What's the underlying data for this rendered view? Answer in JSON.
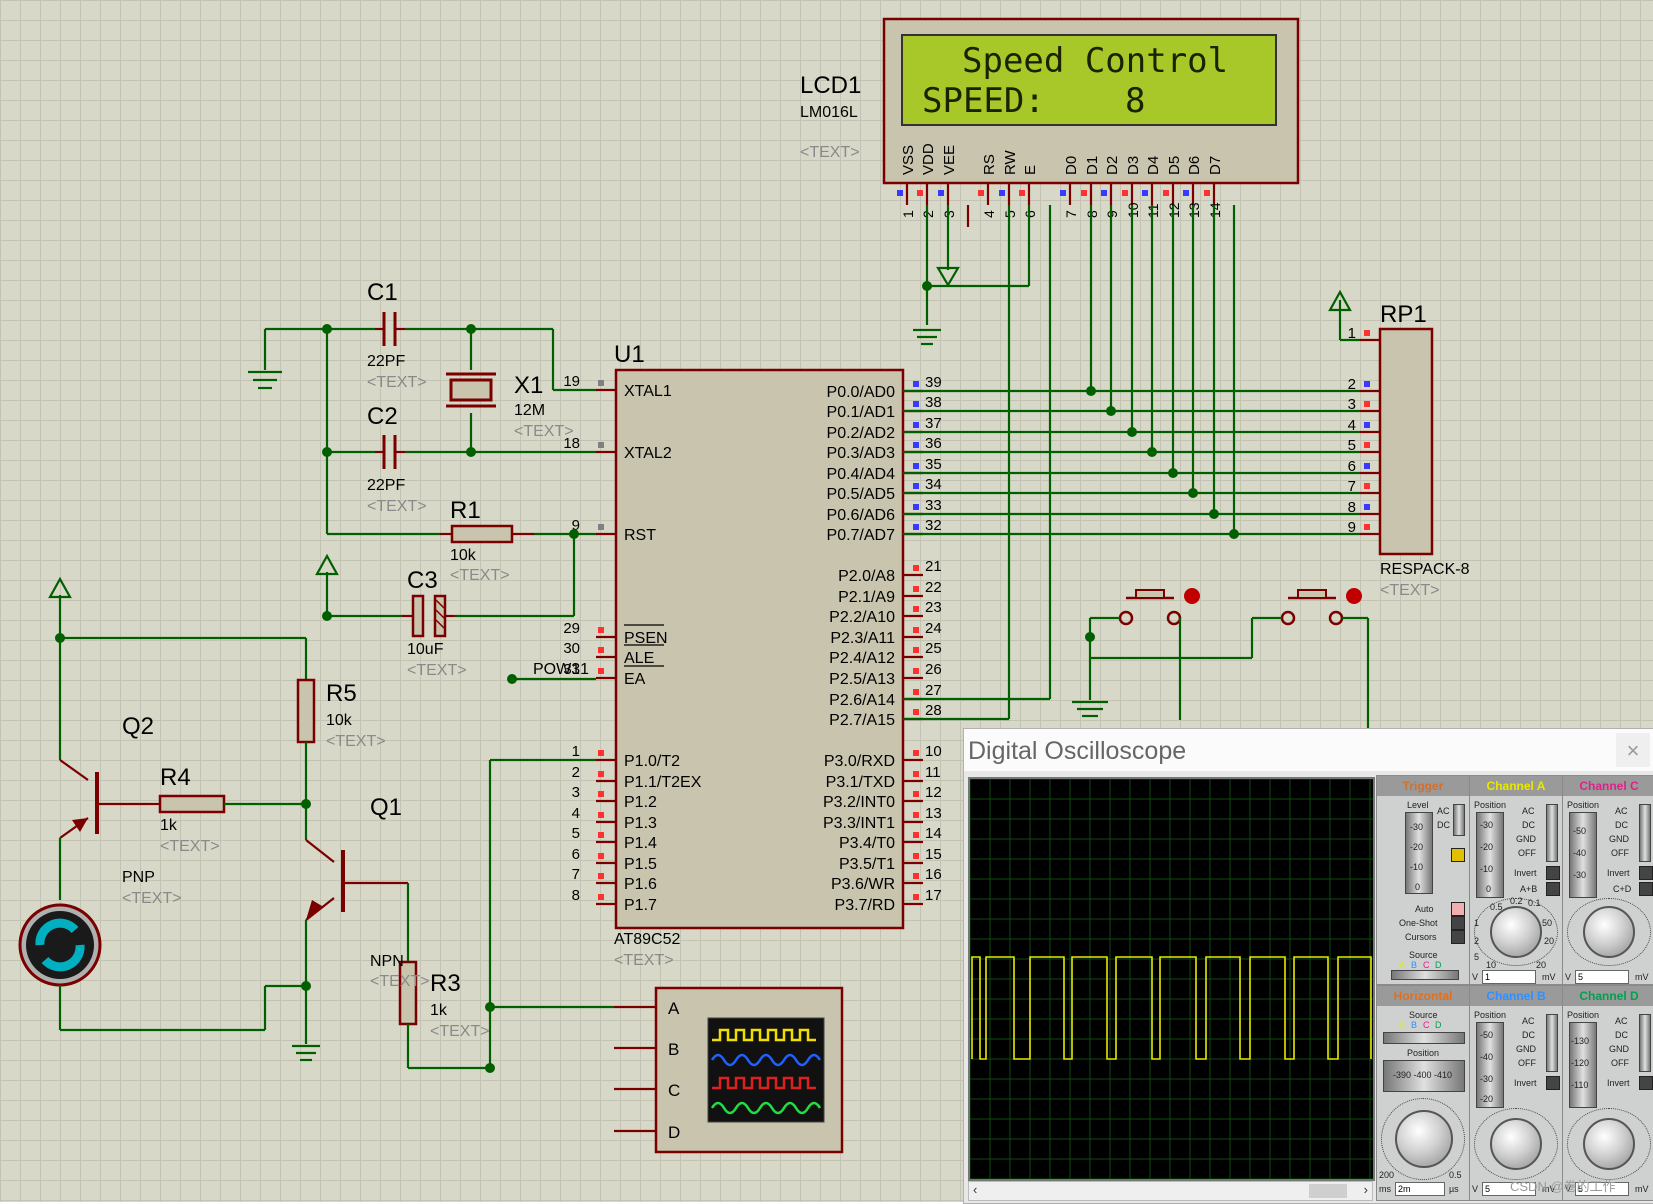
{
  "lcd": {
    "ref": "LCD1",
    "model": "LM016L",
    "text": "<TEXT>",
    "line1": "Speed Control",
    "line2_label": "SPEED:",
    "line2_value": "8",
    "pins": [
      "VSS",
      "VDD",
      "VEE",
      "RS",
      "RW",
      "E",
      "D0",
      "D1",
      "D2",
      "D3",
      "D4",
      "D5",
      "D6",
      "D7"
    ],
    "pin_numbers": [
      "1",
      "2",
      "3",
      "4",
      "5",
      "6",
      "7",
      "8",
      "9",
      "10",
      "11",
      "12",
      "13",
      "14"
    ]
  },
  "mcu": {
    "ref": "U1",
    "model": "AT89C52",
    "text": "<TEXT>",
    "left_pins": [
      {
        "num": "19",
        "name": "XTAL1"
      },
      {
        "num": "18",
        "name": "XTAL2"
      },
      {
        "num": "9",
        "name": "RST"
      },
      {
        "num": "29",
        "name": "PSEN"
      },
      {
        "num": "30",
        "name": "ALE"
      },
      {
        "num": "31",
        "name": "EA"
      },
      {
        "num": "1",
        "name": "P1.0/T2"
      },
      {
        "num": "2",
        "name": "P1.1/T2EX"
      },
      {
        "num": "3",
        "name": "P1.2"
      },
      {
        "num": "4",
        "name": "P1.3"
      },
      {
        "num": "5",
        "name": "P1.4"
      },
      {
        "num": "6",
        "name": "P1.5"
      },
      {
        "num": "7",
        "name": "P1.6"
      },
      {
        "num": "8",
        "name": "P1.7"
      }
    ],
    "right_pins": [
      {
        "num": "39",
        "name": "P0.0/AD0"
      },
      {
        "num": "38",
        "name": "P0.1/AD1"
      },
      {
        "num": "37",
        "name": "P0.2/AD2"
      },
      {
        "num": "36",
        "name": "P0.3/AD3"
      },
      {
        "num": "35",
        "name": "P0.4/AD4"
      },
      {
        "num": "34",
        "name": "P0.5/AD5"
      },
      {
        "num": "33",
        "name": "P0.6/AD6"
      },
      {
        "num": "32",
        "name": "P0.7/AD7"
      },
      {
        "num": "21",
        "name": "P2.0/A8"
      },
      {
        "num": "22",
        "name": "P2.1/A9"
      },
      {
        "num": "23",
        "name": "P2.2/A10"
      },
      {
        "num": "24",
        "name": "P2.3/A11"
      },
      {
        "num": "25",
        "name": "P2.4/A12"
      },
      {
        "num": "26",
        "name": "P2.5/A13"
      },
      {
        "num": "27",
        "name": "P2.6/A14"
      },
      {
        "num": "28",
        "name": "P2.7/A15"
      },
      {
        "num": "10",
        "name": "P3.0/RXD"
      },
      {
        "num": "11",
        "name": "P3.1/TXD"
      },
      {
        "num": "12",
        "name": "P3.2/INT0"
      },
      {
        "num": "13",
        "name": "P3.3/INT1"
      },
      {
        "num": "14",
        "name": "P3.4/T0"
      },
      {
        "num": "15",
        "name": "P3.5/T1"
      },
      {
        "num": "16",
        "name": "P3.6/WR"
      },
      {
        "num": "17",
        "name": "P3.7/RD"
      }
    ],
    "pow_label": "POW31"
  },
  "components": {
    "c1": {
      "ref": "C1",
      "value": "22PF",
      "text": "<TEXT>"
    },
    "c2": {
      "ref": "C2",
      "value": "22PF",
      "text": "<TEXT>"
    },
    "c3": {
      "ref": "C3",
      "value": "10uF",
      "text": "<TEXT>"
    },
    "x1": {
      "ref": "X1",
      "value": "12M",
      "text": "<TEXT>"
    },
    "r1": {
      "ref": "R1",
      "value": "10k",
      "text": "<TEXT>"
    },
    "r3": {
      "ref": "R3",
      "value": "1k",
      "text": "<TEXT>"
    },
    "r4": {
      "ref": "R4",
      "value": "1k",
      "text": "<TEXT>"
    },
    "r5": {
      "ref": "R5",
      "value": "10k",
      "text": "<TEXT>"
    },
    "q1": {
      "ref": "Q1",
      "type": "NPN",
      "text": "<TEXT>"
    },
    "q2": {
      "ref": "Q2",
      "type": "PNP",
      "text": "<TEXT>"
    },
    "rp1": {
      "ref": "RP1",
      "model": "RESPACK-8",
      "text": "<TEXT>",
      "pins": [
        "1",
        "2",
        "3",
        "4",
        "5",
        "6",
        "7",
        "8",
        "9"
      ]
    }
  },
  "scope_symbol": {
    "channels": [
      "A",
      "B",
      "C",
      "D"
    ]
  },
  "oscilloscope": {
    "title": "Digital Oscilloscope",
    "close": "×",
    "trigger": {
      "header": "Trigger",
      "level": "Level",
      "ac": "AC",
      "dc": "DC",
      "auto": "Auto",
      "one_shot": "One-Shot",
      "cursors": "Cursors",
      "source": "Source",
      "src_letters": [
        "A",
        "B",
        "C",
        "D"
      ],
      "ticks": [
        "-30",
        "-20",
        "-10",
        "0"
      ]
    },
    "channel_a": {
      "header": "Channel A",
      "position": "Position",
      "opts": [
        "AC",
        "DC",
        "GND",
        "OFF"
      ],
      "invert": "Invert",
      "apb": "A+B",
      "ticks": [
        "-30",
        "-20",
        "-10",
        "0"
      ],
      "vbox": "1",
      "vunit": "mV",
      "dial": [
        "0.5",
        "0.2",
        "0.1",
        "1",
        "50",
        "2",
        "20",
        "5",
        "10",
        "20"
      ],
      "v": "V"
    },
    "channel_c": {
      "header": "Channel C",
      "position": "Position",
      "opts": [
        "AC",
        "DC",
        "GND",
        "OFF"
      ],
      "invert": "Invert",
      "cpd": "C+D",
      "ticks": [
        "-50",
        "-40",
        "-30"
      ],
      "vbox": "5",
      "vunit": "mV",
      "v": "V"
    },
    "horizontal": {
      "header": "Horizontal",
      "source": "Source",
      "src_letters": [
        "A",
        "B",
        "C",
        "D"
      ],
      "position": "Position",
      "pos_ticks": "-390 -400 -410",
      "box": "2m",
      "ms": "ms",
      "us": "µs",
      "t200": "200",
      "t05": "0.5"
    },
    "channel_b": {
      "header": "Channel B",
      "position": "Position",
      "opts": [
        "AC",
        "DC",
        "GND",
        "OFF"
      ],
      "invert": "Invert",
      "ticks": [
        "-50",
        "-40",
        "-30",
        "-20"
      ],
      "vbox": "5",
      "vunit": "mV",
      "v": "V"
    },
    "channel_d": {
      "header": "Channel D",
      "position": "Position",
      "opts": [
        "AC",
        "DC",
        "GND",
        "OFF"
      ],
      "invert": "Invert",
      "ticks": [
        "-130",
        "-120",
        "-110"
      ],
      "vbox": "5",
      "vunit": "mV",
      "v": "V"
    },
    "colors": {
      "trigger": "#d07030",
      "channel_a": "#e8e800",
      "channel_b": "#3090ff",
      "channel_c": "#e0208a",
      "channel_d": "#00a050",
      "horizontal": "#e07020"
    }
  },
  "watermark": "CSDN @卷的工作"
}
